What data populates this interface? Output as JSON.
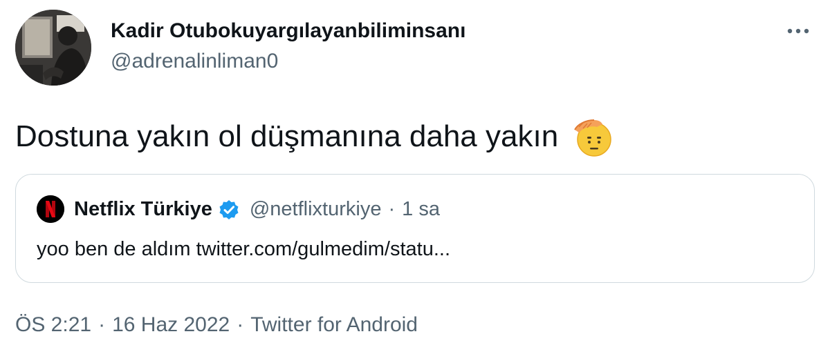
{
  "author": {
    "display_name": "Kadir Otubokuyargılayanbiliminsanı",
    "handle": "@adrenalinliman0"
  },
  "tweet": {
    "text": "Dostuna yakın ol düşmanına daha yakın",
    "emoji": "saluting-face-emoji"
  },
  "quoted_tweet": {
    "display_name": "Netflix Türkiye",
    "verified": true,
    "handle": "@netflixturkiye",
    "separator": "·",
    "time": "1 sa",
    "text": "yoo ben de aldım twitter.com/gulmedim/statu..."
  },
  "meta": {
    "time": "ÖS 2:21",
    "separator": "·",
    "date": "16 Haz 2022",
    "source": "Twitter for Android"
  },
  "colors": {
    "text_primary": "#0f1419",
    "text_secondary": "#536471",
    "border": "#cfd9de",
    "verified_blue": "#1d9bf0",
    "netflix_red": "#e50914"
  },
  "icons": {
    "more": "more-horizontal-icon",
    "verified": "verified-badge-icon",
    "netflix_logo": "netflix-n-logo"
  }
}
